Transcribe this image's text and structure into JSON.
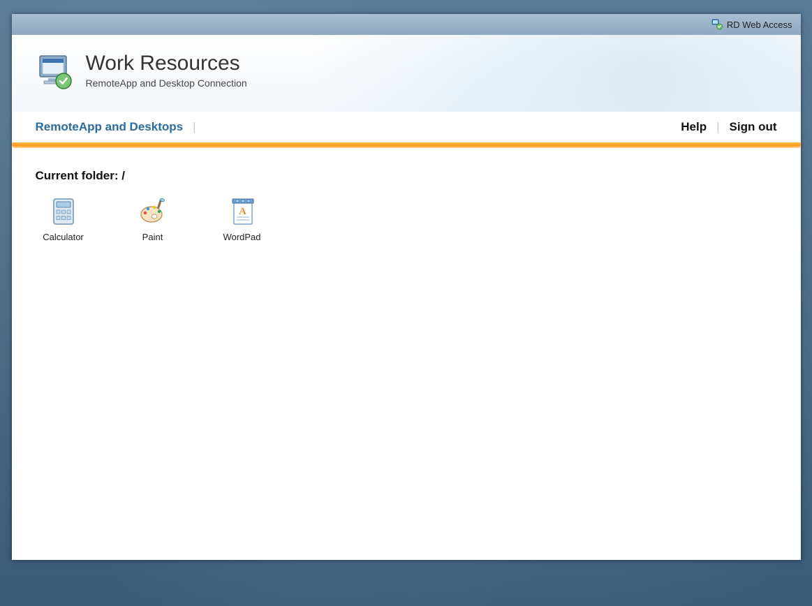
{
  "topbar": {
    "label": "RD Web Access"
  },
  "header": {
    "title": "Work Resources",
    "subtitle": "RemoteApp and Desktop Connection"
  },
  "navbar": {
    "tab_active": "RemoteApp and Desktops",
    "help": "Help",
    "signout": "Sign out"
  },
  "content": {
    "folder_label": "Current folder: /",
    "apps": [
      {
        "name": "Calculator"
      },
      {
        "name": "Paint"
      },
      {
        "name": "WordPad"
      }
    ]
  }
}
